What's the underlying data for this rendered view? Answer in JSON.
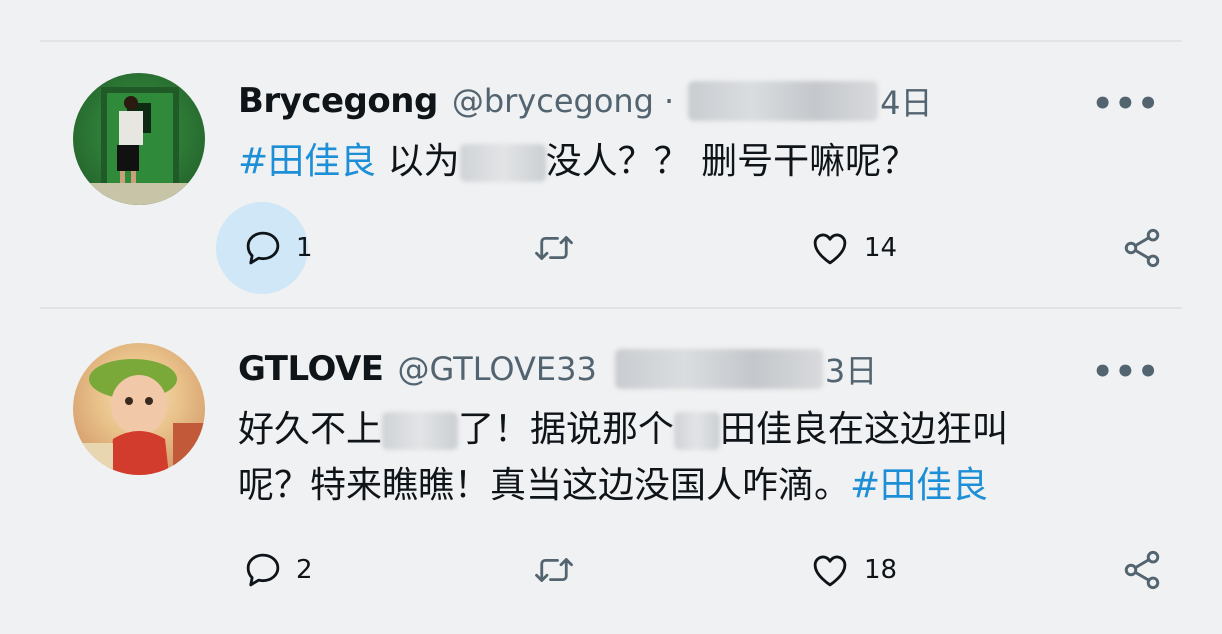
{
  "colors": {
    "background": "#f0f1f2",
    "hashtag": "#1d8fd6",
    "muted": "#536471",
    "reply_highlight": "#cfe7f6"
  },
  "tweets": [
    {
      "name": "Brycegong",
      "handle": "@brycegong",
      "separator": "·",
      "date": "4日",
      "text_parts": {
        "hashtag": "#田佳良",
        "before_blur": " 以为",
        "after_blur": "没人？？ 删号干嘛呢？"
      },
      "more_icon": "more-horizontal-icon",
      "reply_count": "1",
      "retweet_count": "",
      "like_count": "14",
      "reply_highlighted": true
    },
    {
      "name": "GTLOVE",
      "handle": "@GTLOVE33",
      "date": "3日",
      "text_line1_parts": {
        "before_blur": "好久不上",
        "mid": "了！据说那个",
        "after_blur": "田佳良在这边狂叫"
      },
      "text_line2_parts": {
        "main": "呢？特来瞧瞧！真当这边没国人咋滴。",
        "hashtag": "#田佳良"
      },
      "more_icon": "more-horizontal-icon",
      "reply_count": "2",
      "retweet_count": "",
      "like_count": "18",
      "reply_highlighted": false
    }
  ]
}
